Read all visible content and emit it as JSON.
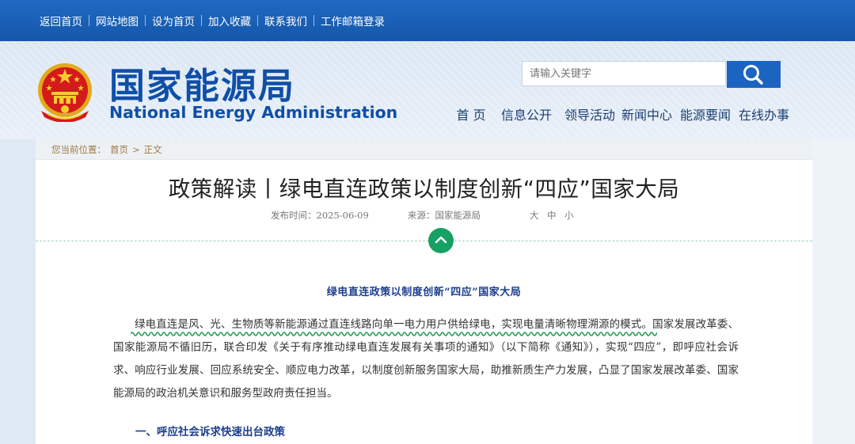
{
  "topbar": {
    "links": [
      "返回首页",
      "网站地图",
      "设为首页",
      "加入收藏",
      "联系我们",
      "工作邮箱登录"
    ]
  },
  "header": {
    "site_name_cn": "国家能源局",
    "site_name_en": "National Energy Administration",
    "emblem_icon": "national-emblem-icon",
    "search_placeholder": "请输入关键字",
    "search_icon": "search-icon",
    "nav": [
      "首 页",
      "信息公开",
      "领导活动",
      "新闻中心",
      "能源要闻",
      "在线办事"
    ]
  },
  "breadcrumb": {
    "prefix": "您当前位置：",
    "items": [
      "首页",
      "正文"
    ],
    "separator": ">"
  },
  "article": {
    "title": "政策解读丨绿电直连政策以制度创新“四应”国家大局",
    "publish_label": "发布时间：2025-06-09",
    "source_label": "来源：国家能源局",
    "font_sizes": [
      "大",
      "中",
      "小"
    ],
    "toggle_icon": "chevron-up-icon",
    "subtitle": "绿电直连政策以制度创新“四应”国家大局",
    "paragraph": "绿电直连是风、光、生物质等新能源通过直连线路向单一电力用户供给绿电，实现电量清晰物理溯源的模式。国家发展改革委、国家能源局不循旧历，联合印发《关于有序推动绿电直连发展有关事项的通知》（以下简称《通知》），实现“四应”，即呼应社会诉求、响应行业发展、回应系统安全、顺应电力改革，以制度创新服务国家大局，助推新质生产力发展，凸显了国家发展改革委、国家能源局的政治机关意识和服务型政府责任担当。",
    "section_heading": "一、呼应社会诉求快速出台政策"
  },
  "colors": {
    "topbar": "#1a5fb8",
    "brand": "#0f4fa8",
    "accent_green": "#17a063",
    "heading_blue": "#1c3f8f"
  }
}
